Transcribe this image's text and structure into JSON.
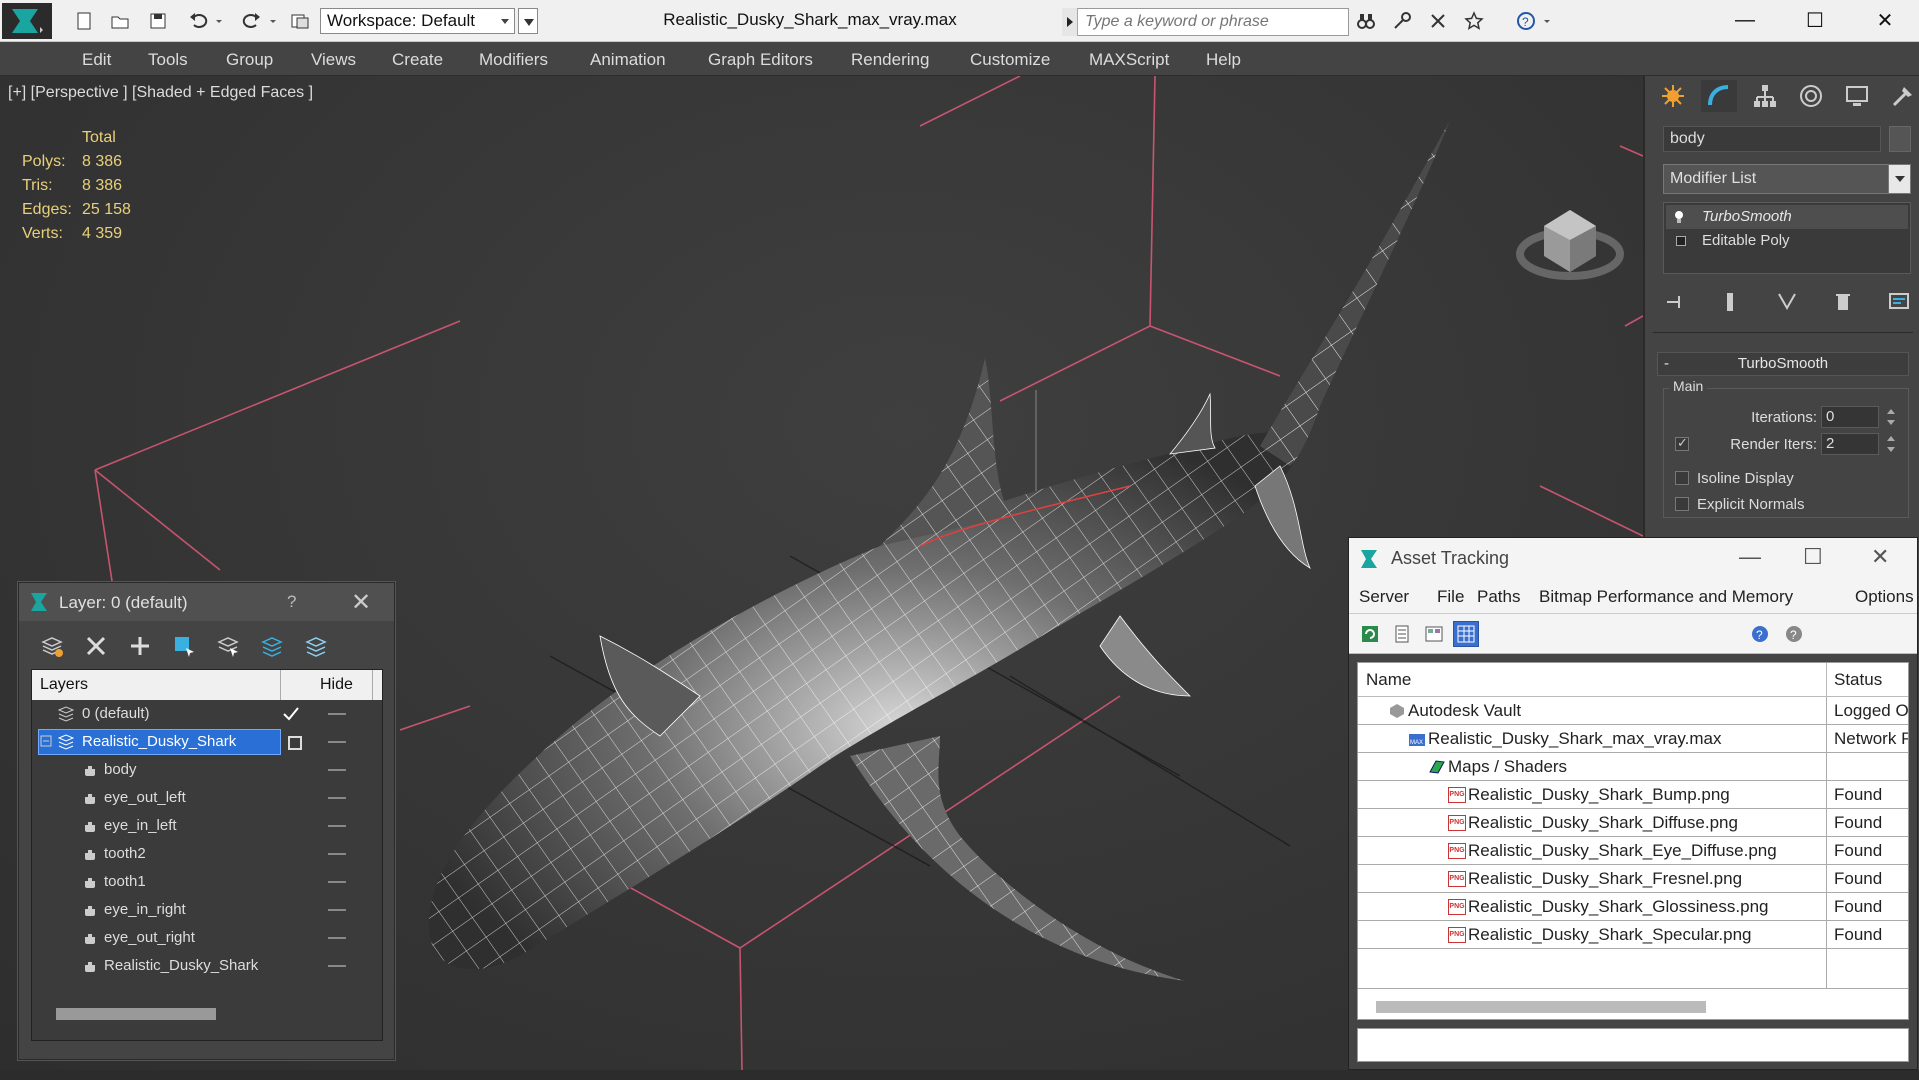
{
  "titlebar": {
    "workspace_label": "Workspace: Default",
    "document_title": "Realistic_Dusky_Shark_max_vray.max",
    "search_placeholder": "Type a keyword or phrase",
    "minimize": "—",
    "maximize": "☐",
    "close": "✕"
  },
  "menu": [
    "Edit",
    "Tools",
    "Group",
    "Views",
    "Create",
    "Modifiers",
    "Animation",
    "Graph Editors",
    "Rendering",
    "Customize",
    "MAXScript",
    "Help"
  ],
  "viewport": {
    "label": "[+] [Perspective ] [Shaded + Edged Faces ]",
    "stats": {
      "header": "Total",
      "rows": [
        {
          "key": "Polys:",
          "value": "8 386"
        },
        {
          "key": "Tris:",
          "value": "8 386"
        },
        {
          "key": "Edges:",
          "value": "25 158"
        },
        {
          "key": "Verts:",
          "value": "4 359"
        }
      ]
    },
    "grid_color": "#e05a7a",
    "wire_color": "#ffffff"
  },
  "command_panel": {
    "object_name": "body",
    "modifier_list": "Modifier List",
    "stack": [
      {
        "label": "TurboSmooth",
        "selected": true
      },
      {
        "label": "Editable Poly",
        "selected": false
      }
    ],
    "rollout_title": "TurboSmooth",
    "rollout_minus": "-",
    "group_label": "Main",
    "iterations_label": "Iterations:",
    "iterations_value": "0",
    "render_iters_label": "Render Iters:",
    "render_iters_value": "2",
    "render_iters_checked": true,
    "isoline_label": "Isoline Display",
    "explicit_normals_label": "Explicit Normals"
  },
  "layer_panel": {
    "title": "Layer: 0 (default)",
    "help": "?",
    "close": "✕",
    "col_layers": "Layers",
    "col_hide": "Hide",
    "rows": [
      {
        "name": "0 (default)",
        "level": 1,
        "type": "layer",
        "current": true
      },
      {
        "name": "Realistic_Dusky_Shark",
        "level": 1,
        "type": "layer",
        "selected": true
      },
      {
        "name": "body",
        "level": 2,
        "type": "object"
      },
      {
        "name": "eye_out_left",
        "level": 2,
        "type": "object"
      },
      {
        "name": "eye_in_left",
        "level": 2,
        "type": "object"
      },
      {
        "name": "tooth2",
        "level": 2,
        "type": "object"
      },
      {
        "name": "tooth1",
        "level": 2,
        "type": "object"
      },
      {
        "name": "eye_in_right",
        "level": 2,
        "type": "object"
      },
      {
        "name": "eye_out_right",
        "level": 2,
        "type": "object"
      },
      {
        "name": "Realistic_Dusky_Shark",
        "level": 2,
        "type": "object"
      }
    ]
  },
  "asset_tracking": {
    "title": "Asset Tracking",
    "menu": [
      "Server",
      "File",
      "Paths",
      "Bitmap Performance and Memory",
      "Options"
    ],
    "col_name": "Name",
    "col_status": "Status",
    "rows": [
      {
        "name": "Autodesk Vault",
        "status": "Logged Out",
        "indent": 1,
        "icon": "vault-icon"
      },
      {
        "name": "Realistic_Dusky_Shark_max_vray.max",
        "status": "Network P",
        "indent": 2,
        "icon": "max-file-icon"
      },
      {
        "name": "Maps / Shaders",
        "status": "",
        "indent": 3,
        "icon": "maps-folder-icon"
      },
      {
        "name": "Realistic_Dusky_Shark_Bump.png",
        "status": "Found",
        "indent": 4,
        "icon": "png-icon"
      },
      {
        "name": "Realistic_Dusky_Shark_Diffuse.png",
        "status": "Found",
        "indent": 4,
        "icon": "png-icon"
      },
      {
        "name": "Realistic_Dusky_Shark_Eye_Diffuse.png",
        "status": "Found",
        "indent": 4,
        "icon": "png-icon"
      },
      {
        "name": "Realistic_Dusky_Shark_Fresnel.png",
        "status": "Found",
        "indent": 4,
        "icon": "png-icon"
      },
      {
        "name": "Realistic_Dusky_Shark_Glossiness.png",
        "status": "Found",
        "indent": 4,
        "icon": "png-icon"
      },
      {
        "name": "Realistic_Dusky_Shark_Specular.png",
        "status": "Found",
        "indent": 4,
        "icon": "png-icon"
      }
    ]
  }
}
